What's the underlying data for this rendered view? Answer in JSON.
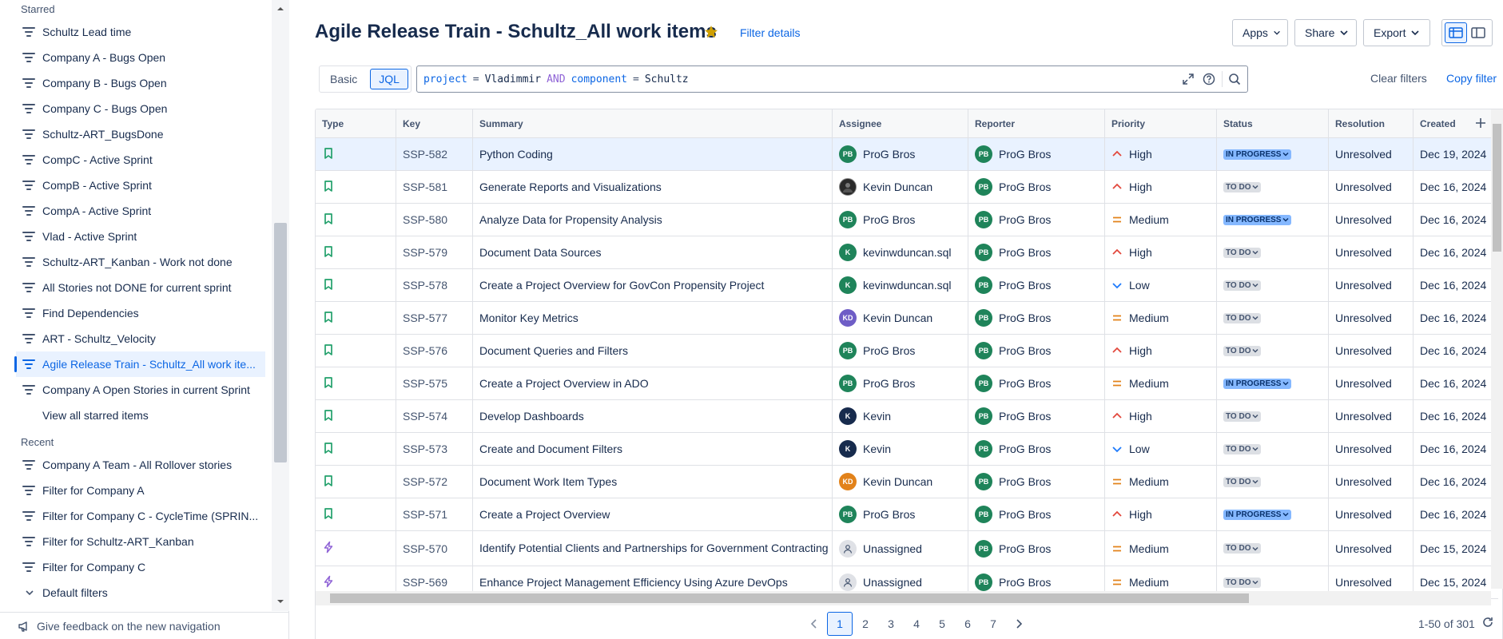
{
  "sidebar": {
    "starred_heading": "Starred",
    "starred": [
      "Schultz Lead time",
      "Company A - Bugs Open",
      "Company B - Bugs Open",
      "Company C - Bugs Open",
      "Schultz-ART_BugsDone",
      "CompC - Active Sprint",
      "CompB - Active Sprint",
      "CompA - Active Sprint",
      "Vlad - Active Sprint",
      "Schultz-ART_Kanban - Work not done",
      "All Stories not DONE for current sprint",
      "Find Dependencies",
      "ART - Schultz_Velocity",
      "Agile Release Train - Schultz_All work ite...",
      "Company A Open Stories in current Sprint"
    ],
    "view_all": "View all starred items",
    "recent_heading": "Recent",
    "recent": [
      "Company A Team - All Rollover stories",
      "Filter for Company A",
      "Filter for Company C - CycleTime (SPRIN...",
      "Filter for Schultz-ART_Kanban",
      "Filter for Company C"
    ],
    "default_filters": "Default filters",
    "feedback": "Give feedback on the new navigation"
  },
  "header": {
    "title": "Agile Release Train - Schultz_All work items",
    "filter_details": "Filter details",
    "apps": "Apps",
    "share": "Share",
    "export": "Export",
    "more": "···"
  },
  "search": {
    "basic": "Basic",
    "jql": "JQL",
    "query": {
      "f1": "project",
      "op1": "=",
      "v1": "Vladimmir",
      "and": "AND",
      "f2": "component",
      "op2": "=",
      "v2": "Schultz"
    },
    "clear_filters": "Clear filters",
    "copy_filter": "Copy filter"
  },
  "table": {
    "columns": [
      "Type",
      "Key",
      "Summary",
      "Assignee",
      "Reporter",
      "Priority",
      "Status",
      "Resolution",
      "Created"
    ],
    "rows": [
      {
        "type": "story",
        "key": "SSP-582",
        "summary": "Python Coding",
        "assignee": "ProG Bros",
        "asg_init": "PB",
        "asg_color": "#1f845a",
        "reporter": "ProG Bros",
        "priority": "High",
        "status": "IN PROGRESS",
        "resolution": "Unresolved",
        "created": "Dec 19, 2024"
      },
      {
        "type": "story",
        "key": "SSP-581",
        "summary": "Generate Reports and Visualizations",
        "assignee": "Kevin Duncan",
        "asg_init": "",
        "asg_color": "photo",
        "reporter": "ProG Bros",
        "priority": "High",
        "status": "TO DO",
        "resolution": "Unresolved",
        "created": "Dec 16, 2024"
      },
      {
        "type": "story",
        "key": "SSP-580",
        "summary": "Analyze Data for Propensity Analysis",
        "assignee": "ProG Bros",
        "asg_init": "PB",
        "asg_color": "#1f845a",
        "reporter": "ProG Bros",
        "priority": "Medium",
        "status": "IN PROGRESS",
        "resolution": "Unresolved",
        "created": "Dec 16, 2024"
      },
      {
        "type": "story",
        "key": "SSP-579",
        "summary": "Document Data Sources",
        "assignee": "kevinwduncan.sql",
        "asg_init": "K",
        "asg_color": "#1f845a",
        "reporter": "ProG Bros",
        "priority": "High",
        "status": "TO DO",
        "resolution": "Unresolved",
        "created": "Dec 16, 2024"
      },
      {
        "type": "story",
        "key": "SSP-578",
        "summary": "Create a Project Overview for GovCon Propensity Project",
        "assignee": "kevinwduncan.sql",
        "asg_init": "K",
        "asg_color": "#1f845a",
        "reporter": "ProG Bros",
        "priority": "Low",
        "status": "TO DO",
        "resolution": "Unresolved",
        "created": "Dec 16, 2024"
      },
      {
        "type": "story",
        "key": "SSP-577",
        "summary": "Monitor Key Metrics",
        "assignee": "Kevin Duncan",
        "asg_init": "KD",
        "asg_color": "#6e5dc6",
        "reporter": "ProG Bros",
        "priority": "Medium",
        "status": "TO DO",
        "resolution": "Unresolved",
        "created": "Dec 16, 2024"
      },
      {
        "type": "story",
        "key": "SSP-576",
        "summary": "Document Queries and Filters",
        "assignee": "ProG Bros",
        "asg_init": "PB",
        "asg_color": "#1f845a",
        "reporter": "ProG Bros",
        "priority": "High",
        "status": "TO DO",
        "resolution": "Unresolved",
        "created": "Dec 16, 2024"
      },
      {
        "type": "story",
        "key": "SSP-575",
        "summary": "Create a Project Overview in ADO",
        "assignee": "ProG Bros",
        "asg_init": "PB",
        "asg_color": "#1f845a",
        "reporter": "ProG Bros",
        "priority": "Medium",
        "status": "IN PROGRESS",
        "resolution": "Unresolved",
        "created": "Dec 16, 2024"
      },
      {
        "type": "story",
        "key": "SSP-574",
        "summary": "Develop Dashboards",
        "assignee": "Kevin",
        "asg_init": "K",
        "asg_color": "#172b4d",
        "reporter": "ProG Bros",
        "priority": "High",
        "status": "TO DO",
        "resolution": "Unresolved",
        "created": "Dec 16, 2024"
      },
      {
        "type": "story",
        "key": "SSP-573",
        "summary": "Create and Document Filters",
        "assignee": "Kevin",
        "asg_init": "K",
        "asg_color": "#172b4d",
        "reporter": "ProG Bros",
        "priority": "Low",
        "status": "TO DO",
        "resolution": "Unresolved",
        "created": "Dec 16, 2024"
      },
      {
        "type": "story",
        "key": "SSP-572",
        "summary": "Document Work Item Types",
        "assignee": "Kevin Duncan",
        "asg_init": "KD",
        "asg_color": "#e2821a",
        "reporter": "ProG Bros",
        "priority": "Medium",
        "status": "TO DO",
        "resolution": "Unresolved",
        "created": "Dec 16, 2024"
      },
      {
        "type": "story",
        "key": "SSP-571",
        "summary": "Create a Project Overview",
        "assignee": "ProG Bros",
        "asg_init": "PB",
        "asg_color": "#1f845a",
        "reporter": "ProG Bros",
        "priority": "High",
        "status": "IN PROGRESS",
        "resolution": "Unresolved",
        "created": "Dec 16, 2024"
      },
      {
        "type": "epic",
        "key": "SSP-570",
        "summary": "Identify Potential Clients and Partnerships for Government Contracting",
        "assignee": "Unassigned",
        "asg_init": "",
        "asg_color": "unassigned",
        "reporter": "ProG Bros",
        "priority": "Medium",
        "status": "TO DO",
        "resolution": "Unresolved",
        "created": "Dec 15, 2024"
      },
      {
        "type": "epic",
        "key": "SSP-569",
        "summary": "Enhance Project Management Efficiency Using Azure DevOps",
        "assignee": "Unassigned",
        "asg_init": "",
        "asg_color": "unassigned",
        "reporter": "ProG Bros",
        "priority": "Medium",
        "status": "TO DO",
        "resolution": "Unresolved",
        "created": "Dec 15, 2024"
      }
    ]
  },
  "pagination": {
    "pages": [
      "1",
      "2",
      "3",
      "4",
      "5",
      "6",
      "7"
    ],
    "current": "1",
    "range": "1-50 of 301"
  },
  "colors": {
    "accent": "#0c66e4",
    "story": "#22a06b",
    "epic": "#8f63d6",
    "high": "#e2483d",
    "medium": "#e2821a",
    "low": "#1d7afc"
  },
  "icons": [
    "star-icon",
    "filter-icon",
    "chevron-down-icon",
    "expand-icon",
    "help-icon",
    "search-icon",
    "story-icon",
    "epic-icon",
    "priority-high-icon",
    "priority-medium-icon",
    "priority-low-icon",
    "refresh-icon",
    "megaphone-icon",
    "plus-icon"
  ]
}
